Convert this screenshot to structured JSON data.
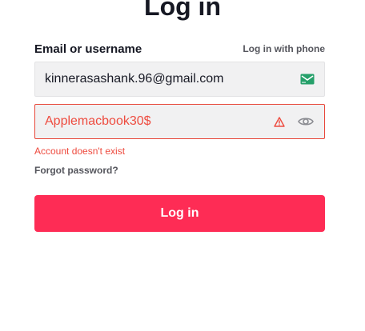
{
  "heading": "Log in",
  "email_section": {
    "label": "Email or username",
    "phone_link": "Log in with phone",
    "value": "kinnerasashank.96@gmail.com",
    "icon": "mail-icon"
  },
  "password_section": {
    "value": "Applemacbook30$",
    "warning_icon": "warning-icon",
    "visibility_icon": "eye-icon"
  },
  "error_message": "Account doesn't exist",
  "forgot_password": "Forgot password?",
  "login_button": "Log in",
  "colors": {
    "primary": "#fe2c55",
    "error": "#ee4b3f",
    "input_bg": "#f1f1f2",
    "text": "#161823"
  }
}
